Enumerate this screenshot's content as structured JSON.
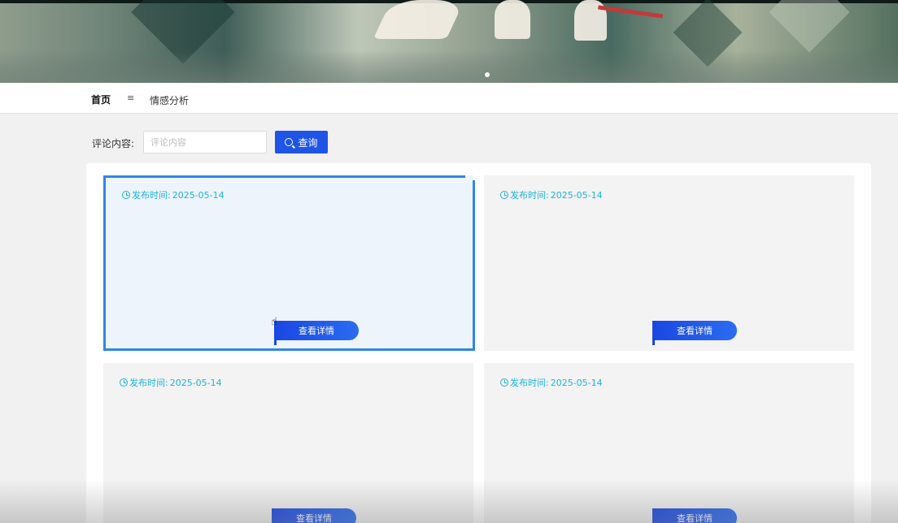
{
  "nav": {
    "home_label": "首页",
    "menu_icon": "≡",
    "analysis_label": "情感分析"
  },
  "search": {
    "label": "评论内容:",
    "placeholder": "评论内容",
    "button_label": "查询"
  },
  "cards": [
    {
      "time_label": "发布时间:",
      "date": "2025-05-14",
      "button_label": "查看详情"
    },
    {
      "time_label": "发布时间:",
      "date": "2025-05-14",
      "button_label": "查看详情"
    },
    {
      "time_label": "发布时间:",
      "date": "2025-05-14",
      "button_label": "查看详情"
    },
    {
      "time_label": "发布时间:",
      "date": "2025-05-14",
      "button_label": "查看详情"
    }
  ],
  "colors": {
    "accent": "#1f55e6",
    "date_text": "#1cb3d9",
    "active_border": "#2f86e8"
  },
  "icons": [
    "search-icon",
    "clock-icon",
    "menu-icon",
    "cursor-icon"
  ]
}
